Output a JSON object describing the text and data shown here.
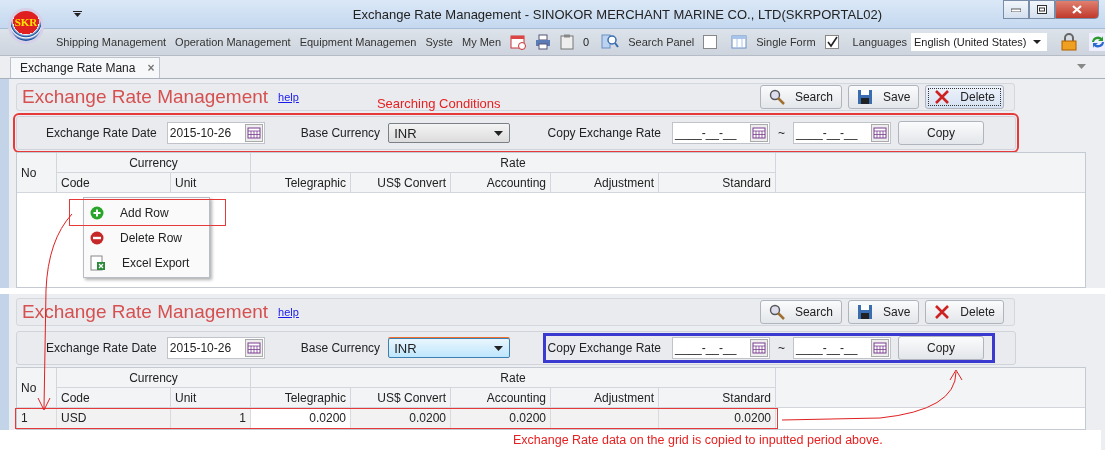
{
  "window": {
    "title": "Exchange Rate Management - SINOKOR MERCHANT MARINE CO., LTD(SKRPORTAL02)",
    "logo": "SKR"
  },
  "menu": [
    "Shipping Management",
    "Operation Management",
    "Equipment Managemen",
    "Syste",
    "My Men"
  ],
  "toolbar": {
    "count": "0",
    "search_panel": {
      "label": "Search Panel",
      "checked": false
    },
    "single_form": {
      "label": "Single Form",
      "checked": true
    },
    "languages": {
      "label": "Languages",
      "value": "English (United States)"
    }
  },
  "tabs": [
    {
      "label": "Exchange Rate Mana",
      "close": "×",
      "selected": true
    }
  ],
  "panels": [
    {
      "title": "Exchange Rate Management",
      "help": "help",
      "annotation": "Searching Conditions",
      "conditions_highlighted": true,
      "copy_highlighted": false,
      "buttons": [
        {
          "kind": "search",
          "label": "Search",
          "focused": false
        },
        {
          "kind": "save",
          "label": "Save",
          "focused": false
        },
        {
          "kind": "delete",
          "label": "Delete",
          "focused": true
        }
      ],
      "date_label": "Exchange Rate Date",
      "date": "2015-10-26",
      "base_label": "Base Currency",
      "base": "INR",
      "base_focused": false,
      "copy_label": "Copy Exchange Rate",
      "copy_from": "____-__-__",
      "tilde": "~",
      "copy_to": "____-__-__",
      "copy_button": "Copy",
      "grid": {
        "no": "No",
        "groups": [
          "Currency",
          "Rate"
        ],
        "columns": [
          "Code",
          "Unit",
          "Telegraphic",
          "US$ Convert",
          "Accounting",
          "Adjustment",
          "Standard"
        ]
      },
      "context_menu": [
        {
          "kind": "add",
          "label": "Add Row",
          "highlighted": true
        },
        {
          "kind": "delete",
          "label": "Delete Row",
          "highlighted": false
        },
        {
          "kind": "excel",
          "label": "Excel Export",
          "highlighted": false
        }
      ]
    },
    {
      "title": "Exchange Rate Management",
      "help": "help",
      "conditions_highlighted": false,
      "copy_highlighted": true,
      "buttons": [
        {
          "kind": "search",
          "label": "Search",
          "focused": false
        },
        {
          "kind": "save",
          "label": "Save",
          "focused": false
        },
        {
          "kind": "delete",
          "label": "Delete",
          "focused": false
        }
      ],
      "date_label": "Exchange Rate Date",
      "date": "2015-10-26",
      "base_label": "Base Currency",
      "base": "INR",
      "base_focused": true,
      "copy_label": "Copy Exchange Rate",
      "copy_from": "____-__-__",
      "tilde": "~",
      "copy_to": "____-__-__",
      "copy_button": "Copy",
      "grid": {
        "no": "No",
        "groups": [
          "Currency",
          "Rate"
        ],
        "columns": [
          "Code",
          "Unit",
          "Telegraphic",
          "US$ Convert",
          "Accounting",
          "Adjustment",
          "Standard"
        ]
      },
      "rows": [
        {
          "cells": [
            "1",
            "USD",
            "1",
            "0.0200",
            "0.0200",
            "0.0200",
            "",
            "0.0200"
          ],
          "highlighted": true
        }
      ],
      "note": "Exchange Rate data on the grid is copied to inputted period above."
    }
  ]
}
